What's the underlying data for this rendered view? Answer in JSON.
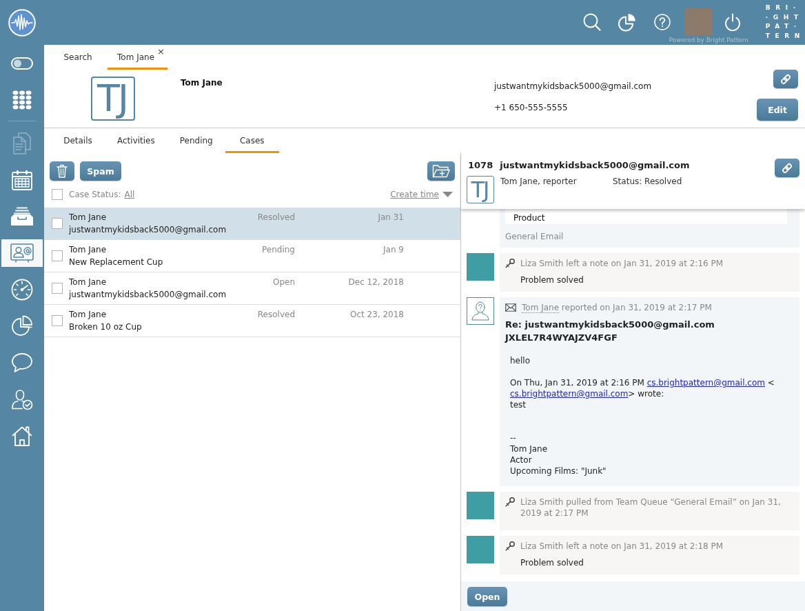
{
  "top_bar": {
    "powered_by": "Powered by Bright Pattern",
    "logo_lines": [
      "BRI·",
      "·GHT",
      "PAT·",
      "TERN"
    ]
  },
  "sidebar": {
    "groups": [
      {
        "items": [
          {
            "selected": false,
            "disabled": false
          },
          {
            "selected": false,
            "disabled": false
          }
        ]
      },
      {
        "items": [
          {
            "selected": false,
            "disabled": true
          },
          {
            "selected": false,
            "disabled": false
          },
          {
            "selected": false,
            "disabled": false
          },
          {
            "selected": true,
            "disabled": false
          },
          {
            "selected": false,
            "disabled": false
          },
          {
            "selected": false,
            "disabled": false
          },
          {
            "selected": false,
            "disabled": false
          },
          {
            "selected": false,
            "disabled": false
          },
          {
            "selected": false,
            "disabled": false
          }
        ]
      }
    ]
  },
  "tabs": [
    {
      "label": "Search",
      "selected": false
    },
    {
      "label": "Tom Jane",
      "selected": true,
      "close": "×"
    }
  ],
  "contact": {
    "initials": "TJ",
    "name": "Tom Jane",
    "email": "justwantmykidsback5000@gmail.com",
    "phone": "+1 650-555-5555",
    "edit_button": "Edit"
  },
  "detail_tabs": [
    {
      "label": "Details",
      "selected": false
    },
    {
      "label": "Activities",
      "selected": false
    },
    {
      "label": "Pending",
      "selected": false
    },
    {
      "label": "Cases",
      "selected": true
    }
  ],
  "case_list": {
    "spam_button": "Spam",
    "all_checked": false,
    "filter_label": "Case Status:",
    "filter_value": "All",
    "sort_label": "Create time",
    "rows": [
      {
        "name": "Tom Jane",
        "subject": "justwantmykidsback5000@gmail.com",
        "status": "Resolved",
        "date": "Jan 31",
        "selected": true,
        "checked": false
      },
      {
        "name": "Tom Jane",
        "subject": "New Replacement Cup",
        "status": "Pending",
        "date": "Jan 9",
        "selected": false,
        "checked": false
      },
      {
        "name": "Tom Jane",
        "subject": "justwantmykidsback5000@gmail.com",
        "status": "Open",
        "date": "Dec 12, 2018",
        "selected": false,
        "checked": false
      },
      {
        "name": "Tom Jane",
        "subject": "Broken 10 oz Cup",
        "status": "Resolved",
        "date": "Oct 23, 2018",
        "selected": false,
        "checked": false
      }
    ]
  },
  "case_detail": {
    "number": "1078",
    "title": "justwantmykidsback5000@gmail.com",
    "initials": "TJ",
    "reporter": "Tom Jane, reporter",
    "status": "Status: Resolved",
    "timeline": [
      {
        "kind": "case_info",
        "field_value": "Product",
        "queue": "General Email"
      },
      {
        "kind": "note",
        "text": "Liza Smith left a note on Jan 31, 2019 at 2:16 PM",
        "note": "Problem solved"
      },
      {
        "kind": "email",
        "author": "Tom Jane",
        "text": "reported on Jan 31, 2019 at 2:17 PM",
        "subject": "Re: justwantmykidsback5000@gmail.com JXLEL7R4WYAJZV4FGF",
        "body": [
          {
            "kind": "paragraph",
            "lines": [
              "hello"
            ]
          },
          {
            "kind": "quote",
            "intro": "On Thu, Jan 31, 2019 at 2:16 PM",
            "links": [
              "cs.brightpattern@gmail.com",
              "cs.brightpattern@gmail.com"
            ],
            "between": "<",
            "outro": "> wrote:",
            "lines": [
              "test"
            ]
          },
          {
            "kind": "signature",
            "lines": [
              "--",
              "Tom Jane",
              "Actor",
              "Upcoming Films: \"Junk\""
            ]
          }
        ]
      },
      {
        "kind": "assignment",
        "text": "Liza Smith pulled from Team Queue “General Email” on Jan 31, 2019 at 2:17 PM"
      },
      {
        "kind": "note",
        "text": "Liza Smith left a note on Jan 31, 2019 at 2:18 PM",
        "note": "Problem solved"
      }
    ],
    "open_button": "Open"
  }
}
